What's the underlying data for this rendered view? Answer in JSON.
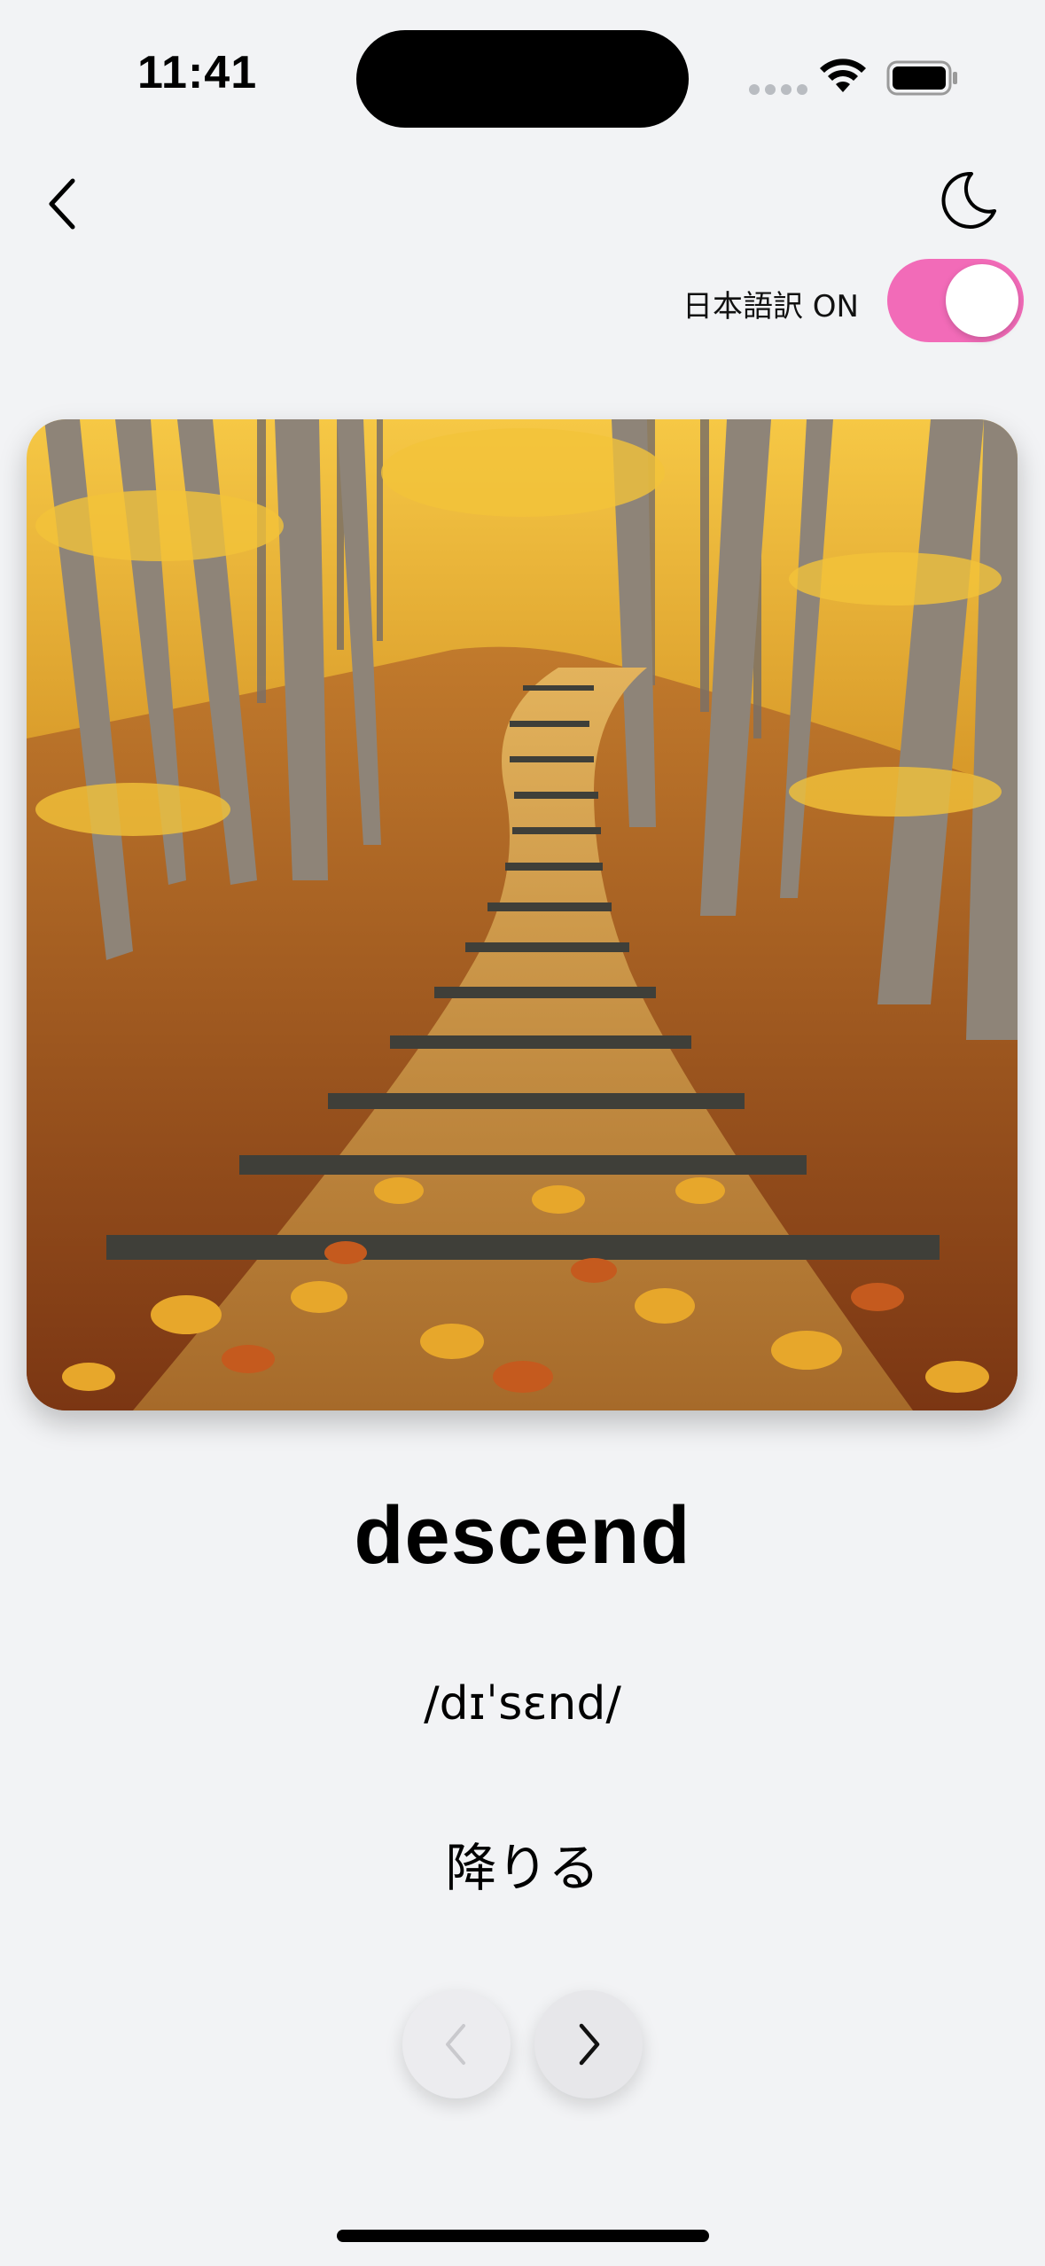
{
  "status_bar": {
    "time": "11:41",
    "icons": [
      "cellular-icon",
      "wifi-icon",
      "battery-icon"
    ]
  },
  "nav": {
    "back_icon": "chevron-left-icon",
    "theme_icon": "moon-icon"
  },
  "translation": {
    "label": "日本語訳 ON",
    "enabled": true,
    "toggle_color": "#f26bb8"
  },
  "card": {
    "image": "autumn-forest-stairs"
  },
  "word": {
    "text": "descend",
    "pronunciation": "/dɪˈsɛnd/",
    "meaning": "降りる"
  },
  "pager": {
    "prev_icon": "chevron-left-icon",
    "prev_enabled": false,
    "next_icon": "chevron-right-icon",
    "next_enabled": true
  },
  "colors": {
    "background": "#f2f3f5",
    "accent": "#f26bb8"
  }
}
